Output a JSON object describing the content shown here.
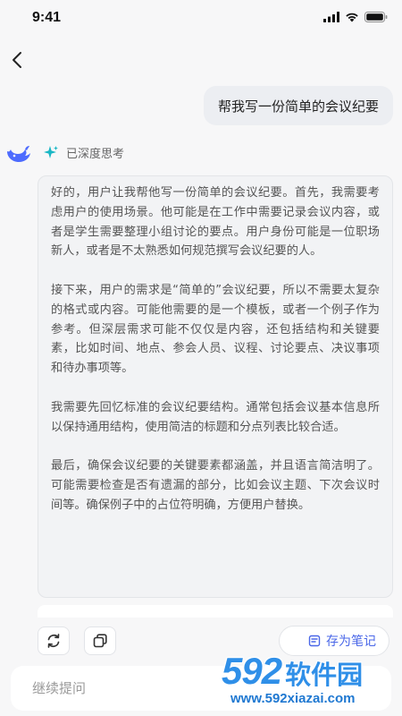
{
  "status_bar": {
    "time": "9:41"
  },
  "conversation": {
    "user_message": "帮我写一份简单的会议纪要",
    "thinking": {
      "label": "已深度思考",
      "paragraphs": [
        "好的，用户让我帮他写一份简单的会议纪要。首先，我需要考虑用户的使用场景。他可能是在工作中需要记录会议内容，或者是学生需要整理小组讨论的要点。用户身份可能是一位职场新人，或者是不太熟悉如何规范撰写会议纪要的人。",
        "接下来，用户的需求是“简单的”会议纪要，所以不需要太复杂的格式或内容。可能他需要的是一个模板，或者一个例子作为参考。但深层需求可能不仅仅是内容，还包括结构和关键要素，比如时间、地点、参会人员、议程、讨论要点、决议事项和待办事项等。",
        "我需要先回忆标准的会议纪要结构。通常包括会议基本信息所以保持通用结构，使用简洁的标题和分点列表比较合适。",
        "最后，确保会议纪要的关键要素都涵盖，并且语言简洁明了。可能需要检查是否有遗漏的部分，比如会议主题、下次会议时间等。确保例子中的占位符明确，方便用户替换。"
      ]
    }
  },
  "actions": {
    "save_note_label": "存为笔记"
  },
  "input": {
    "placeholder": "继续提问"
  },
  "watermark": {
    "brand_num": "592",
    "brand_cn": "软件园",
    "url": "www.592xiazai.com"
  },
  "colors": {
    "accent": "#4a67e8",
    "watermark": "#2f8fe8",
    "sparkle": "#18b6c4",
    "bot_logo": "#4d6bfe"
  }
}
